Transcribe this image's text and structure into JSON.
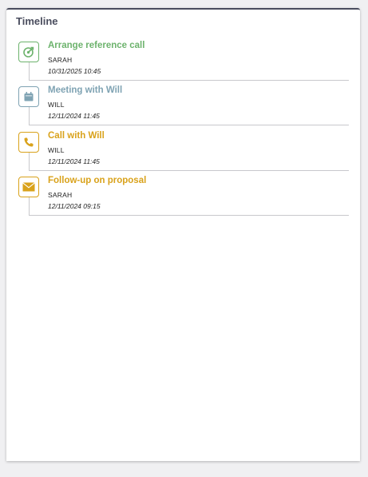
{
  "panel": {
    "title": "Timeline"
  },
  "colors": {
    "task": "#6db36d",
    "meeting": "#7fa3b3",
    "call": "#d9a21b",
    "email": "#d9a21b"
  },
  "items": [
    {
      "type": "task",
      "icon": "target-icon",
      "title": "Arrange reference call",
      "user": "SARAH",
      "date": "10/31/2025 10:45"
    },
    {
      "type": "meeting",
      "icon": "calendar-icon",
      "title": "Meeting with Will",
      "user": "WILL",
      "date": "12/11/2024 11:45"
    },
    {
      "type": "call",
      "icon": "phone-icon",
      "title": "Call with Will",
      "user": "WILL",
      "date": "12/11/2024 11:45"
    },
    {
      "type": "email",
      "icon": "envelope-icon",
      "title": "Follow-up on proposal",
      "user": "SARAH",
      "date": "12/11/2024 09:15"
    }
  ]
}
